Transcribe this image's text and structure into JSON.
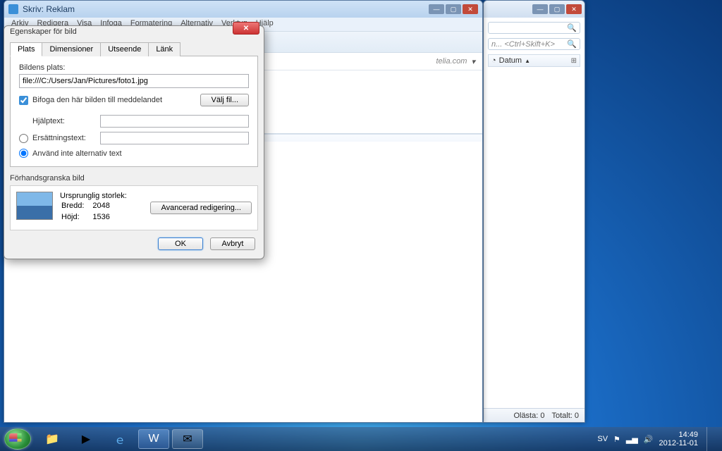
{
  "compose": {
    "title": "Skriv: Reklam",
    "menu": [
      "Arkiv",
      "Redigera",
      "Visa",
      "Infoga",
      "Formatering",
      "Alternativ",
      "Verktyg",
      "Hjälp"
    ],
    "address_hint": "telia.com"
  },
  "back_window": {
    "search_hint": "n... <Ctrl+Skift+K>",
    "column": "Datum",
    "status_unread": "Olästa: 0",
    "status_total": "Totalt: 0"
  },
  "dialog": {
    "title": "Egenskaper för bild",
    "tabs": [
      "Plats",
      "Dimensioner",
      "Utseende",
      "Länk"
    ],
    "location_label": "Bildens plats:",
    "location_value": "file:///C:/Users/Jan/Pictures/foto1.jpg",
    "attach_label": "Bifoga den här bilden till meddelandet",
    "choose_file": "Välj fil...",
    "tooltip_label": "Hjälptext:",
    "alt_label": "Ersättningstext:",
    "noalt_label": "Använd inte alternativ text",
    "preview_title": "Förhandsgranska bild",
    "orig_size": "Ursprunglig storlek:",
    "width_label": "Bredd:",
    "width_value": "2048",
    "height_label": "Höjd:",
    "height_value": "1536",
    "advanced": "Avancerad redigering...",
    "ok": "OK",
    "cancel": "Avbryt"
  },
  "tray": {
    "lang": "SV",
    "time": "14:49",
    "date": "2012-11-01"
  }
}
